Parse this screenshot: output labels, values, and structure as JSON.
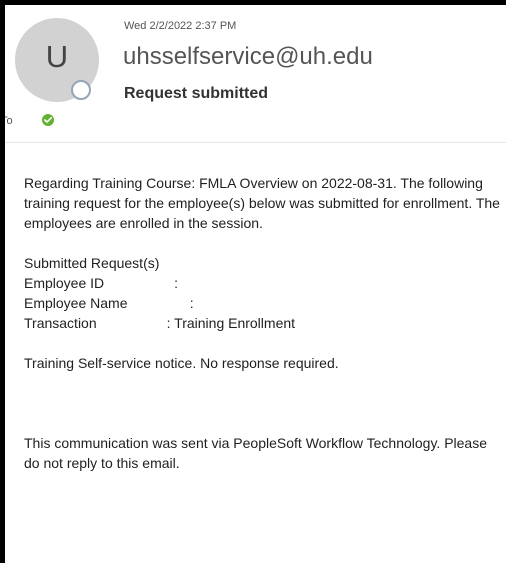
{
  "message": {
    "sent_date": "Wed 2/2/2022 2:37 PM",
    "sender_initial": "U",
    "sender": "uhsselfservice@uh.edu",
    "subject": "Request submitted",
    "to_label": "To",
    "avatar_color": "#d2d2d2",
    "status_color": "#64b032",
    "icons": [
      "avatar",
      "presence-status-icon",
      "check-icon"
    ]
  },
  "body": {
    "intro": "Regarding Training Course:  FMLA Overview on 2022-08-31.  The following training request for the employee(s) below was submitted for enrollment. The employees are enrolled in the session.",
    "details_heading": "Submitted Request(s)",
    "employee_id": "Employee ID                  :",
    "employee_name": "Employee Name                :",
    "transaction": "Transaction                  : Training Enrollment",
    "notice": "Training Self-service notice. No response required.",
    "footer": "This communication was sent via PeopleSoft Workflow Technology.  Please do not reply to this email."
  }
}
